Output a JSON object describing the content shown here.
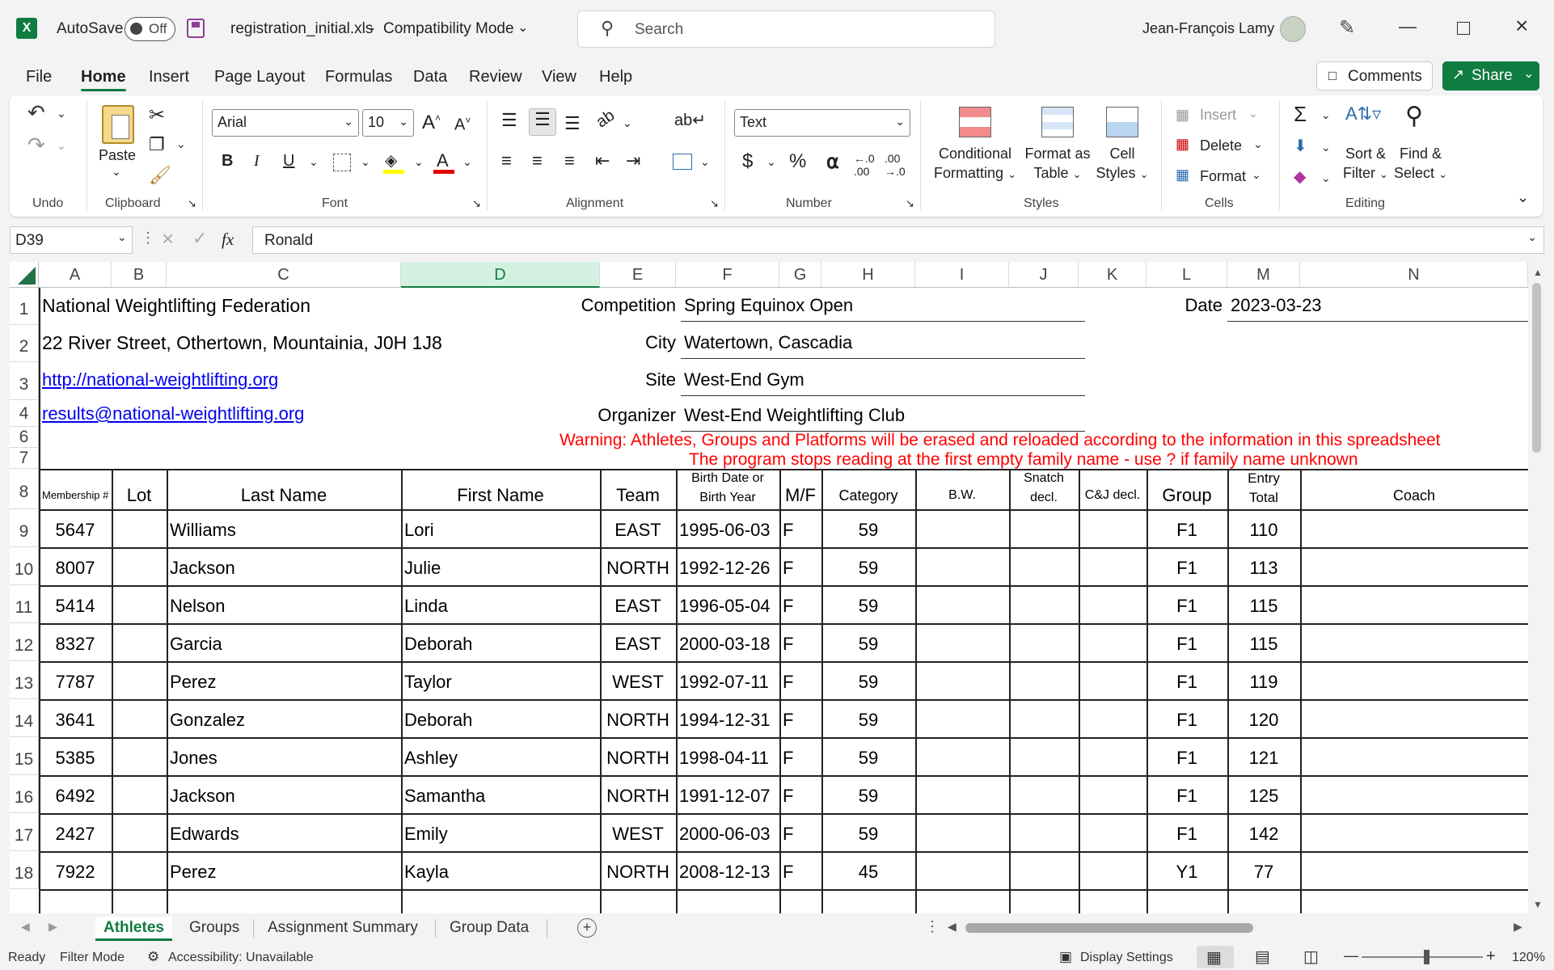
{
  "titlebar": {
    "autosave_label": "AutoSave",
    "autosave_state": "Off",
    "filename": "registration_initial.xls",
    "separator": "-",
    "mode": "Compatibility Mode",
    "search_placeholder": "Search",
    "user_name": "Jean-François Lamy"
  },
  "tabs": [
    "File",
    "Home",
    "Insert",
    "Page Layout",
    "Formulas",
    "Data",
    "Review",
    "View",
    "Help"
  ],
  "active_tab": "Home",
  "comments_label": "Comments",
  "share_label": "Share",
  "ribbon": {
    "undo_group": "Undo",
    "clipboard_group": "Clipboard",
    "paste_label": "Paste",
    "font_group": "Font",
    "font_name": "Arial",
    "font_size": "10",
    "alignment_group": "Alignment",
    "number_group": "Number",
    "number_format": "Text",
    "styles_group": "Styles",
    "cond_format_1": "Conditional",
    "cond_format_2": "Formatting",
    "format_table_1": "Format as",
    "format_table_2": "Table",
    "cell_styles_1": "Cell",
    "cell_styles_2": "Styles",
    "cells_group": "Cells",
    "insert_label": "Insert",
    "delete_label": "Delete",
    "format_label": "Format",
    "editing_group": "Editing",
    "sort_1": "Sort &",
    "sort_2": "Filter",
    "find_1": "Find &",
    "find_2": "Select"
  },
  "formula_bar": {
    "name_box": "D39",
    "fx": "fx",
    "content": "Ronald"
  },
  "columns": [
    "A",
    "B",
    "C",
    "D",
    "E",
    "F",
    "G",
    "H",
    "I",
    "J",
    "K",
    "L",
    "M",
    "N"
  ],
  "header_block": {
    "r1_a": "National Weightlifting Federation",
    "r2_a": "22 River Street, Othertown, Mountainia,  J0H 1J8",
    "r3_a": "http://national-weightlifting.org",
    "r4_a": "results@national-weightlifting.org",
    "competition_label": "Competition",
    "competition_value": "Spring Equinox Open",
    "city_label": "City",
    "city_value": "Watertown, Cascadia",
    "site_label": "Site",
    "site_value": "West-End Gym",
    "organizer_label": "Organizer",
    "organizer_value": "West-End Weightlifting Club",
    "date_label": "Date",
    "date_value": "2023-03-23",
    "warning_1": "Warning: Athletes, Groups and Platforms will be erased and reloaded according to the information in this spreadsheet",
    "warning_2": "The program stops reading at the first empty family name - use ? if family name unknown"
  },
  "table_headers": {
    "membership": "Membership #",
    "lot": "Lot",
    "last_name": "Last Name",
    "first_name": "First Name",
    "team": "Team",
    "birth_1": "Birth Date or",
    "birth_2": "Birth Year",
    "mf": "M/F",
    "category": "Category",
    "bw": "B.W.",
    "snatch_1": "Snatch",
    "snatch_2": "decl.",
    "cj": "C&J decl.",
    "group": "Group",
    "entry_1": "Entry",
    "entry_2": "Total",
    "coach": "Coach"
  },
  "athletes": [
    {
      "row": "9",
      "membership": "5647",
      "last": "Williams",
      "first": "Lori",
      "team": "EAST",
      "birth": "1995-06-03",
      "sex": "F",
      "category": "59",
      "group": "F1",
      "total": "110"
    },
    {
      "row": "10",
      "membership": "8007",
      "last": "Jackson",
      "first": "Julie",
      "team": "NORTH",
      "birth": "1992-12-26",
      "sex": "F",
      "category": "59",
      "group": "F1",
      "total": "113"
    },
    {
      "row": "11",
      "membership": "5414",
      "last": "Nelson",
      "first": "Linda",
      "team": "EAST",
      "birth": "1996-05-04",
      "sex": "F",
      "category": "59",
      "group": "F1",
      "total": "115"
    },
    {
      "row": "12",
      "membership": "8327",
      "last": "Garcia",
      "first": "Deborah",
      "team": "EAST",
      "birth": "2000-03-18",
      "sex": "F",
      "category": "59",
      "group": "F1",
      "total": "115"
    },
    {
      "row": "13",
      "membership": "7787",
      "last": "Perez",
      "first": "Taylor",
      "team": "WEST",
      "birth": "1992-07-11",
      "sex": "F",
      "category": "59",
      "group": "F1",
      "total": "119"
    },
    {
      "row": "14",
      "membership": "3641",
      "last": "Gonzalez",
      "first": "Deborah",
      "team": "NORTH",
      "birth": "1994-12-31",
      "sex": "F",
      "category": "59",
      "group": "F1",
      "total": "120"
    },
    {
      "row": "15",
      "membership": "5385",
      "last": "Jones",
      "first": "Ashley",
      "team": "NORTH",
      "birth": "1998-04-11",
      "sex": "F",
      "category": "59",
      "group": "F1",
      "total": "121"
    },
    {
      "row": "16",
      "membership": "6492",
      "last": "Jackson",
      "first": "Samantha",
      "team": "NORTH",
      "birth": "1991-12-07",
      "sex": "F",
      "category": "59",
      "group": "F1",
      "total": "125"
    },
    {
      "row": "17",
      "membership": "2427",
      "last": "Edwards",
      "first": "Emily",
      "team": "WEST",
      "birth": "2000-06-03",
      "sex": "F",
      "category": "59",
      "group": "F1",
      "total": "142"
    },
    {
      "row": "18",
      "membership": "7922",
      "last": "Perez",
      "first": "Kayla",
      "team": "NORTH",
      "birth": "2008-12-13",
      "sex": "F",
      "category": "45",
      "group": "Y1",
      "total": "77"
    }
  ],
  "row_numbers": [
    "1",
    "2",
    "3",
    "4",
    "6",
    "7",
    "8"
  ],
  "sheet_tabs": [
    "Athletes",
    "Groups",
    "Assignment Summary",
    "Group Data"
  ],
  "active_sheet": "Athletes",
  "status": {
    "ready": "Ready",
    "filter_mode": "Filter Mode",
    "accessibility": "Accessibility: Unavailable",
    "display_settings": "Display Settings",
    "zoom": "120%"
  },
  "colors": {
    "accent": "#107c41",
    "warning": "#ff0000",
    "link": "#0000ee"
  }
}
